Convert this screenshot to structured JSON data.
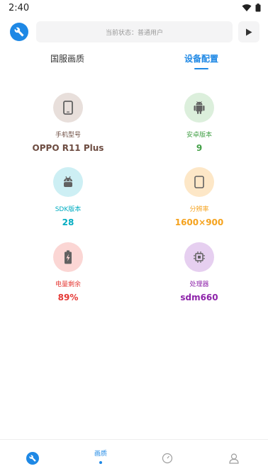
{
  "status_bar": {
    "time": "2:40"
  },
  "topbar": {
    "status_text": "当前状态：普通用户"
  },
  "tabs": [
    {
      "label": "国服画质"
    },
    {
      "label": "设备配置"
    }
  ],
  "device": [
    {
      "label": "手机型号",
      "value": "OPPO R11 Plus",
      "color": "#6d4c41",
      "bg": "#e8dfdb",
      "icon": "phone-icon"
    },
    {
      "label": "安卓版本",
      "value": "9",
      "color": "#43a047",
      "bg": "#dcefdc",
      "icon": "android-icon"
    },
    {
      "label": "SDK版本",
      "value": "28",
      "color": "#00acc1",
      "bg": "#cdeff4",
      "icon": "android-robot-icon"
    },
    {
      "label": "分辨率",
      "value": "1600×900",
      "color": "#f5a21d",
      "bg": "#fde7c7",
      "icon": "screen-icon"
    },
    {
      "label": "电量剩余",
      "value": "89%",
      "color": "#e53935",
      "bg": "#fbd6d4",
      "icon": "battery-icon"
    },
    {
      "label": "处理器",
      "value": "sdm660",
      "color": "#8e24aa",
      "bg": "#e6cff0",
      "icon": "chip-icon"
    }
  ],
  "bottom_nav": {
    "active_label": "画质"
  },
  "colors": {
    "accent": "#1e88e5"
  }
}
